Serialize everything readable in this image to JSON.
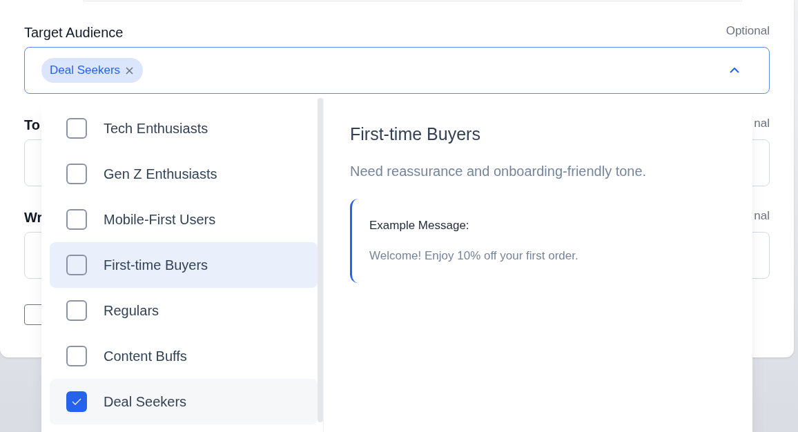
{
  "target_audience": {
    "label": "Target Audience",
    "optional": "Optional",
    "chips": [
      {
        "label": "Deal Seekers"
      }
    ],
    "expanded": true
  },
  "hidden_fields": [
    {
      "label": "To",
      "optional": "nal"
    },
    {
      "label": "Wr",
      "optional": "nal"
    }
  ],
  "dropdown": {
    "options": [
      {
        "label": "Tech Enthusiasts",
        "checked": false,
        "selected": false
      },
      {
        "label": "Gen Z Enthusiasts",
        "checked": false,
        "selected": false
      },
      {
        "label": "Mobile-First Users",
        "checked": false,
        "selected": false
      },
      {
        "label": "First-time Buyers",
        "checked": false,
        "selected": true
      },
      {
        "label": "Regulars",
        "checked": false,
        "selected": false
      },
      {
        "label": "Content Buffs",
        "checked": false,
        "selected": false
      },
      {
        "label": "Deal Seekers",
        "checked": true,
        "selected": false
      }
    ],
    "preview": {
      "title": "First-time Buyers",
      "description": "Need reassurance and onboarding-friendly tone.",
      "example_label": "Example Message:",
      "example": "Welcome! Enjoy 10% off your first order."
    }
  }
}
